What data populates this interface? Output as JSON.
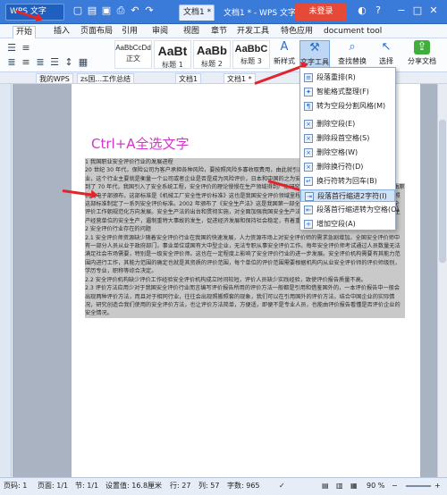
{
  "titlebar": {
    "app_menu": "WPS 文字",
    "doc_tab": "文档1 *",
    "window_title": "文档1 * - WPS 文字",
    "login_button": "未登录"
  },
  "menu_tabs": [
    "开始",
    "插入",
    "页面布局",
    "引用",
    "审阅",
    "视图",
    "章节",
    "开发工具",
    "特色应用",
    "document tool"
  ],
  "ribbon": {
    "styles": [
      {
        "sample": "AaBbCcDd",
        "name": "正文"
      },
      {
        "sample": "AaBt",
        "name": "标题 1"
      },
      {
        "sample": "AaBb",
        "name": "标题 2"
      },
      {
        "sample": "AaBbC",
        "name": "标题 3"
      }
    ],
    "new_style": "新样式",
    "text_tools": "文字工具",
    "find_replace": "查找替换",
    "select": "选择",
    "share": "分享文档"
  },
  "doc_tabs": [
    "我的WPS",
    "zs国...工作总结",
    "文档1",
    "文档1 *"
  ],
  "document": {
    "heading": "Ctrl+A全选文字",
    "paragraphs": [
      "1 我国职业安全评价行业的发展进程",
      "20 世纪 30 年代，保险公司为客户承担各种风险，要按照风险多寡收取费用，由此就引出了安全评价行业，这个行业主要就是衡量一个公司或者企业是否是成为风险评价，日本和中国的之为安全评价。",
      "到了 70 年代，我国引入了安全系统工程，安全评价的理论慢慢在生产领域得到广泛研究。1988 年，我国第一部安全评价标准由原机械电子部颁布，这部标准是《机械工厂安全性评价标准》这也是我国安全评价领域里程碑式的记录，此后，我国各部门纷纷参照这部标准制定了一系列安全评价标准。2002 年颁布了《安全生产法》这是我国第一部全面规范安全生产的专门法律，它推动安全评价工作朝规范化方向发展。安全生产法的出台和贯彻实施，对全面加强我国安全生产法制建设，强化安全生产监督管理，规范生产经营单位的安全生产，遏制重特大事故的发生，促进经济发展和保持社会稳定，有着重要的现实意义和深远的历史意义。",
      "2 安全评价行业存在的问题",
      "2.1 安全评价师资源缺少随着安全评价行业在我国的快速发展，人力资源市场上对安全评价师的需求急剧增加。全国安全评价师中有一部分人员从业于政府部门，事业单位或国有大中型企业，无法专职从事安全评价工作。每年安全评价师考试通过人员数量无法满足社会市场需要，特别是一级安全评价师。这也在一定程度上影响了安全评价行业的进一步发展。安全评价机构需要有其能力范围内进行工作，其能力范围的确定也就是其资质的评价范围，每个单位的评价范围需要根据机构内从业安全评价师的评价师级别，学历专业，职称等综合决定。",
      "2.2 安全评价机构缺少评价工作经验安全评价机构成立时间较短，评价人员缺少实践经验，致使评价报告质量不高。",
      "2.3 评价方法应用少对于我国安全评价行业而言编写评价报告所用的评价方法一般都是引用和借鉴国外的，一本评价报告中一般会出现两种评价方法，而且对于相同行业，往往会出现照搬照套的现象，我们可以在引用国外的评价方法，结合中国企业的实际情况，研究创造合我们使用的安全评价方法，也让评价方法简单，方便适，即便不是专业人员，也能由评价报告看懂是否评价企业的安全情况。"
    ]
  },
  "dropdown": {
    "items": [
      "段落重排(R)",
      "智能格式整理(F)",
      "转为空段分割风格(M)",
      "删除空段(E)",
      "删除段首空格(S)",
      "删除空格(W)",
      "删除换行符(D)",
      "换行符转为回车(B)",
      "段落首行缩进2字符(I)",
      "段落首行缩进转为空格(O)",
      "增加空段(A)"
    ],
    "highlighted_index": 8
  },
  "statusbar": {
    "page": "页码: 1",
    "pages": "页面: 1/1",
    "section": "节: 1/1",
    "position": "设置值: 16.8厘米",
    "row": "行: 27",
    "col": "列: 57",
    "words": "字数: 965",
    "zoom": "90 %"
  },
  "colors": {
    "titlebar": "#3a7ad8",
    "login": "#e44a37",
    "heading": "#d236c8",
    "arrow": "#e0262d",
    "highlight": "#cfe2f8"
  }
}
